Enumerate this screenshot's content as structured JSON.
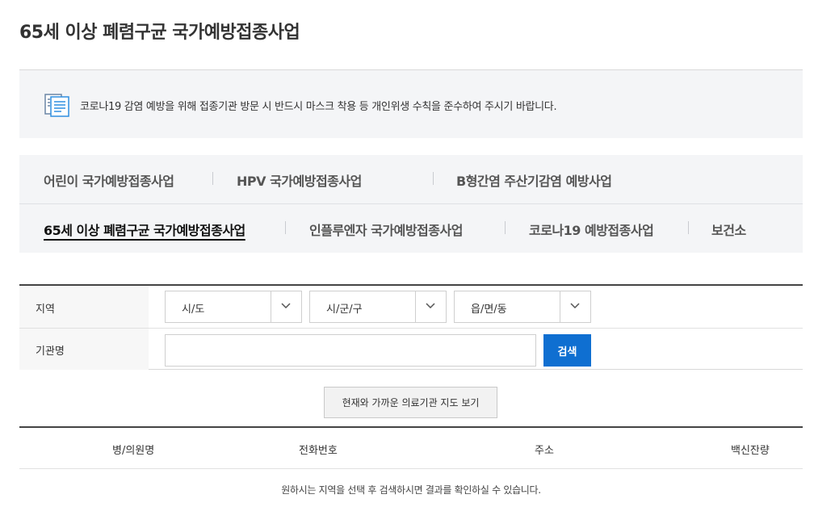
{
  "page": {
    "title": "65세 이상 폐렴구균 국가예방접종사업"
  },
  "notice": {
    "icon": "document-list-icon",
    "text": "코로나19 감염 예방을 위해 접종기관 방문 시 반드시 마스크 착용 등 개인위생 수칙을 준수하여 주시기 바랍니다."
  },
  "tabs": {
    "row1": [
      {
        "label": "어린이 국가예방접종사업",
        "active": false
      },
      {
        "label": "HPV 국가예방접종사업",
        "active": false
      },
      {
        "label": "B형간염 주산기감염 예방사업",
        "active": false
      }
    ],
    "row2": [
      {
        "label": "65세 이상 폐렴구균 국가예방접종사업",
        "active": true
      },
      {
        "label": "인플루엔자 국가예방접종사업",
        "active": false
      },
      {
        "label": "코로나19 예방접종사업",
        "active": false
      },
      {
        "label": "보건소",
        "active": false
      }
    ]
  },
  "search": {
    "region_label": "지역",
    "selects": [
      {
        "value": "시/도"
      },
      {
        "value": "시/군/구"
      },
      {
        "value": "읍/면/동"
      }
    ],
    "institution_label": "기관명",
    "institution_value": "",
    "institution_placeholder": "",
    "search_button": "검색"
  },
  "map_button": "현재와 가까운 의료기관 지도 보기",
  "results": {
    "columns": [
      "병/의원명",
      "전화번호",
      "주소",
      "백신잔량"
    ],
    "empty_message": "원하시는 지역을 선택 후 검색하시면 결과를 확인하실 수 있습니다."
  },
  "colors": {
    "accent": "#0f6fd1",
    "panel_bg": "#f4f5f7"
  }
}
